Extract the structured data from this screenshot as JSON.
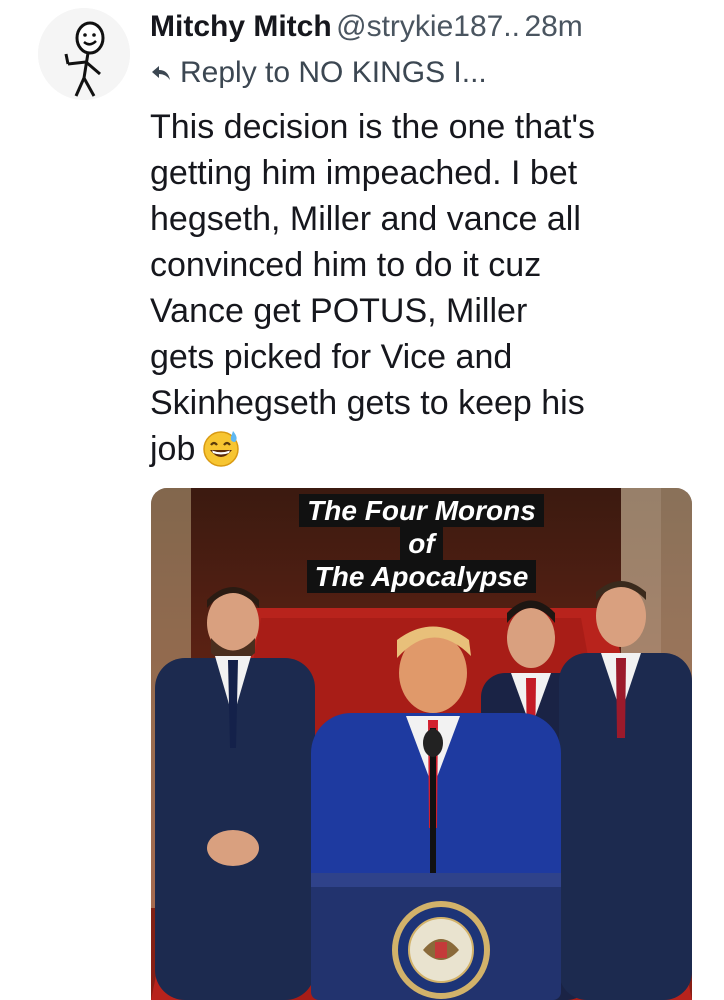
{
  "post": {
    "author_name": "Mitchy Mitch",
    "handle": "@strykie187..",
    "time": "28m",
    "reply_text": "Reply to NO KINGS I...",
    "body_lines": [
      "This decision is the one that's",
      "getting him impeached. I bet",
      "hegseth, Miller and vance all",
      "convinced him to do it cuz",
      "Vance get POTUS, Miller",
      "gets picked for Vice and",
      "Skinhegseth gets to keep his",
      "job"
    ],
    "emoji": "sweat-smile-emoji",
    "image": {
      "title_lines": [
        "The Four Morons",
        "of",
        "The Apocalypse"
      ],
      "seal_text": "SEAL OF THE PRESIDENT OF THE UNITED STATES"
    }
  },
  "colors": {
    "text": "#16171d",
    "muted": "#4a5560",
    "carpet_red": "#b8231c",
    "suit_navy": "#1c2a4f"
  }
}
